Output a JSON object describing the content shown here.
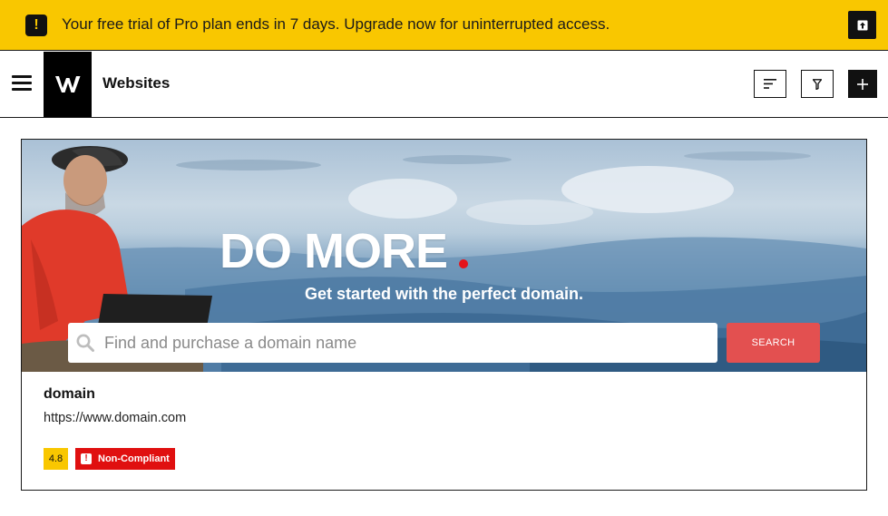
{
  "banner": {
    "warning_icon": "exclamation-icon",
    "text": "Your free trial of Pro plan ends in 7 days. Upgrade now for uninterrupted access.",
    "action_icon": "arrow-up-icon",
    "warn_glyph": "!"
  },
  "header": {
    "menu_icon": "hamburger-icon",
    "logo_icon": "w-logo",
    "title": "Websites",
    "sort_icon": "sort-icon",
    "filter_icon": "filter-icon",
    "add_icon": "plus-icon"
  },
  "hero": {
    "title": "DO MORE",
    "subtitle": "Get started with the perfect domain.",
    "search_placeholder": "Find and purchase a domain name",
    "search_button": "SEARCH",
    "accent_color": "#e4141b"
  },
  "site": {
    "name": "domain",
    "url": "https://www.domain.com",
    "score": "4.8",
    "status": "Non-Compliant",
    "status_glyph": "!"
  },
  "colors": {
    "brand_yellow": "#f9c700",
    "danger_red": "#e01010",
    "search_red": "#e35050"
  }
}
